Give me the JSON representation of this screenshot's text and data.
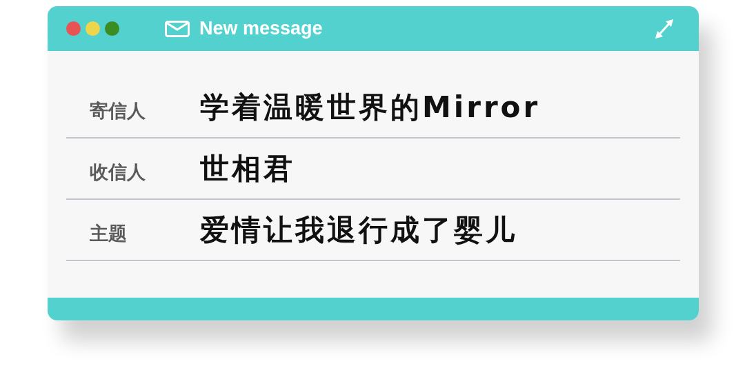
{
  "window": {
    "title": "New message",
    "controls": [
      {
        "color": "#e85454"
      },
      {
        "color": "#eed64c"
      },
      {
        "color": "#3c8c24"
      }
    ]
  },
  "fields": [
    {
      "label": "寄信人",
      "value": "学着温暖世界的Mirror"
    },
    {
      "label": "收信人",
      "value": "世相君"
    },
    {
      "label": "主题",
      "value": "爱情让我退行成了婴儿"
    }
  ]
}
